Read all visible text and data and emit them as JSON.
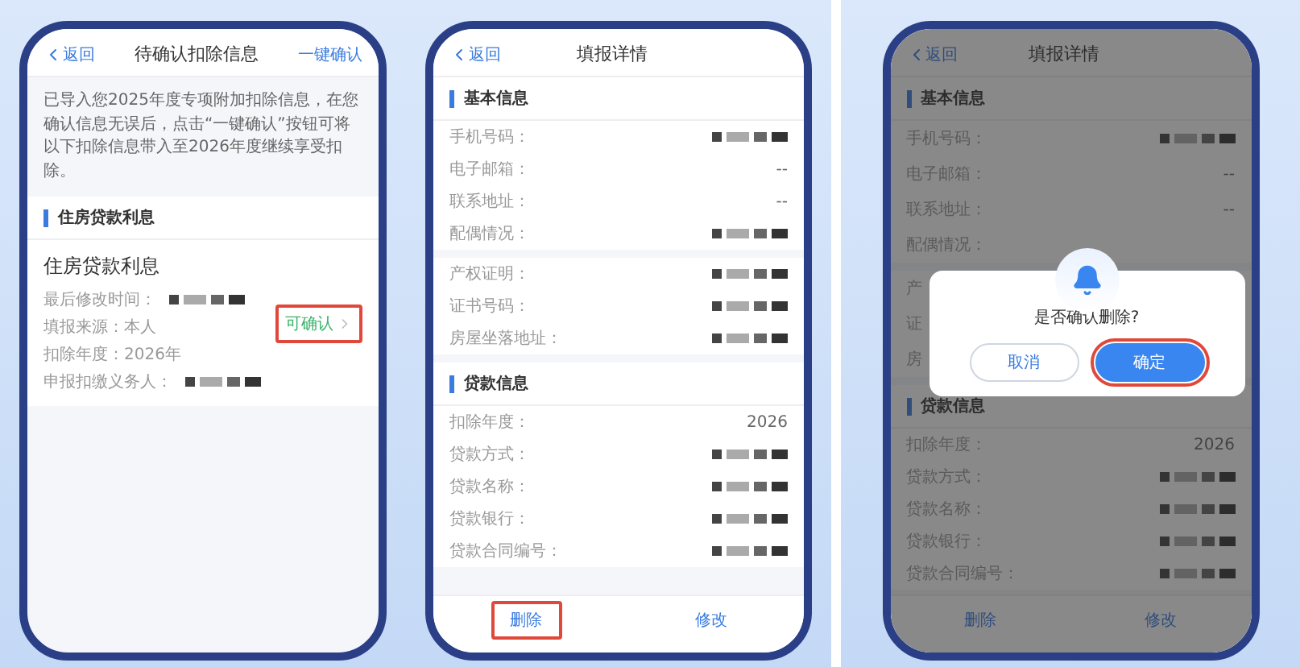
{
  "phones": [
    {
      "kind": "pending",
      "header": {
        "back": "返回",
        "title": "待确认扣除信息",
        "action": "一键确认"
      },
      "notice": "已导入您2025年度专项附加扣除信息，在您确认信息无误后，点击“一键确认”按钮可将以下扣除信息带入至2026年度继续享受扣除。",
      "section": "住房贷款利息",
      "card": {
        "title": "住房贷款利息",
        "lines": [
          {
            "label": "最后修改时间：",
            "redacted": true
          },
          {
            "label": "填报来源：本人",
            "redacted": false
          },
          {
            "label": "扣除年度：2026年",
            "redacted": false
          },
          {
            "label": "申报扣缴义务人：",
            "redacted": true
          }
        ],
        "status": {
          "label": "可确认",
          "highlighted": true
        }
      }
    },
    {
      "kind": "detail",
      "header": {
        "back": "返回",
        "title": "填报详情"
      },
      "groups": [
        {
          "heading": "基本信息",
          "rows": [
            {
              "label": "手机号码：",
              "redacted": true
            },
            {
              "label": "电子邮箱：",
              "value": "--",
              "redacted": false
            },
            {
              "label": "联系地址：",
              "value": "--",
              "redacted": false
            },
            {
              "label": "配偶情况：",
              "redacted": true
            }
          ]
        },
        {
          "rows": [
            {
              "label": "产权证明：",
              "redacted": true
            },
            {
              "label": "证书号码：",
              "redacted": true
            },
            {
              "label": "房屋坐落地址：",
              "redacted": true
            }
          ]
        },
        {
          "heading": "贷款信息",
          "rows": [
            {
              "label": "扣除年度：",
              "value": "2026",
              "redacted": false
            },
            {
              "label": "贷款方式：",
              "redacted": true
            },
            {
              "label": "贷款名称：",
              "redacted": true
            },
            {
              "label": "贷款银行：",
              "redacted": true
            },
            {
              "label": "贷款合同编号：",
              "redacted": true
            }
          ]
        }
      ],
      "buttons": [
        {
          "label": "删除",
          "highlighted": true
        },
        {
          "label": "修改",
          "highlighted": false
        }
      ]
    },
    {
      "kind": "detail",
      "header": {
        "back": "返回",
        "title": "填报详情"
      },
      "groups": [
        {
          "heading": "基本信息",
          "rows": [
            {
              "label": "手机号码：",
              "redacted": true
            },
            {
              "label": "电子邮箱：",
              "value": "--",
              "redacted": false
            },
            {
              "label": "联系地址：",
              "value": "--",
              "redacted": false
            },
            {
              "label": "配偶情况：",
              "redacted": false
            }
          ]
        },
        {
          "rows": [
            {
              "label": "产"
            },
            {
              "label": "证"
            },
            {
              "label": "房"
            }
          ]
        },
        {
          "heading": "贷款信息",
          "rows": [
            {
              "label": "扣除年度：",
              "value": "2026",
              "redacted": false
            },
            {
              "label": "贷款方式：",
              "redacted": true
            },
            {
              "label": "贷款名称：",
              "redacted": true
            },
            {
              "label": "贷款银行：",
              "redacted": true
            },
            {
              "label": "贷款合同编号：",
              "redacted": true
            }
          ]
        }
      ],
      "buttons": [
        {
          "label": "删除",
          "highlighted": false
        },
        {
          "label": "修改",
          "highlighted": false
        }
      ],
      "dialog": {
        "message": "是否确认删除?",
        "buttons": [
          {
            "label": "取消",
            "kind": "secondary",
            "highlighted": false
          },
          {
            "label": "确定",
            "kind": "primary",
            "highlighted": true
          }
        ]
      }
    }
  ]
}
